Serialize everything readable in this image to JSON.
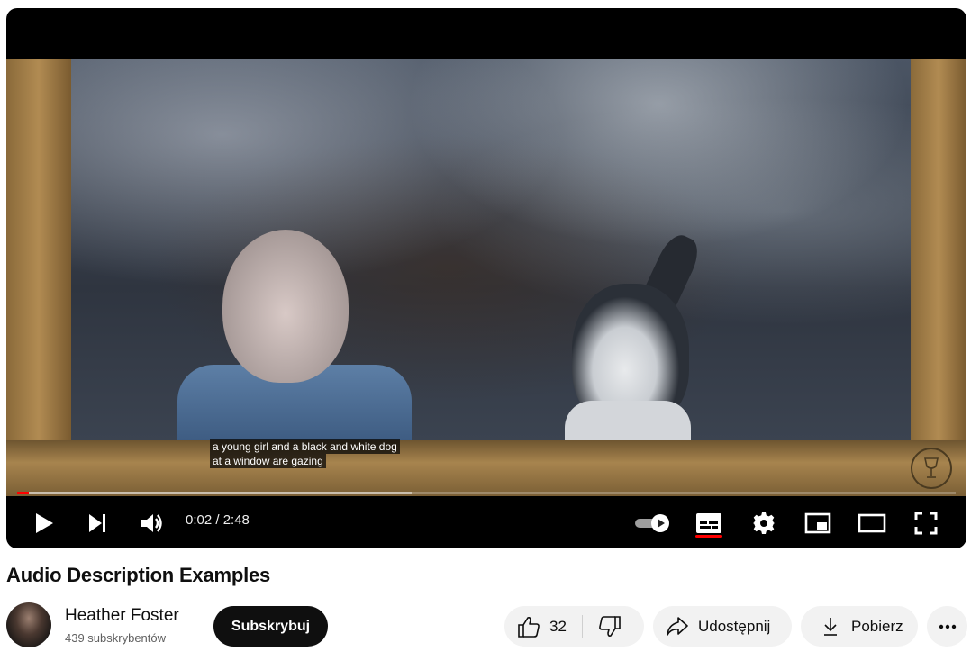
{
  "video": {
    "caption_line1": "a young girl and a black and white dog",
    "caption_line2": "at a window are gazing",
    "progress_fraction": 0.012,
    "buffered_fraction": 0.42
  },
  "controls": {
    "time_display": "0:02 / 2:48",
    "autoplay_on": true,
    "captions_on": true,
    "accent_color": "#ff0000"
  },
  "title": "Audio Description Examples",
  "channel": {
    "name": "Heather Foster",
    "subscribers": "439 subskrybentów"
  },
  "actions": {
    "subscribe_label": "Subskrybuj",
    "like_count": "32",
    "share_label": "Udostępnij",
    "download_label": "Pobierz"
  }
}
